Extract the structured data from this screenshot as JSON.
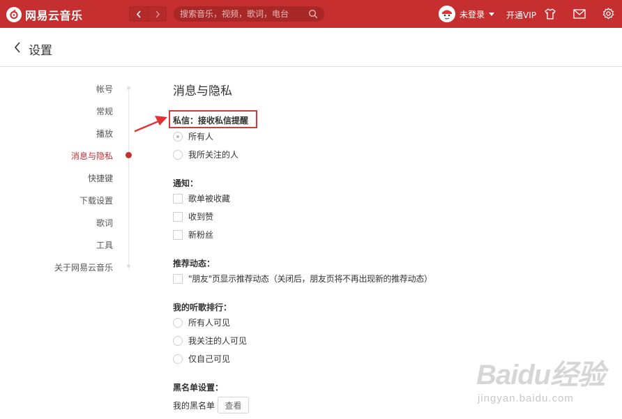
{
  "app": {
    "name": "网易云音乐",
    "search_placeholder": "搜索音乐，视频，歌词，电台",
    "user_name": "未登录",
    "vip_label": "开通VIP",
    "brand_color": "#c62f2f"
  },
  "header": {
    "title": "设置"
  },
  "sidebar": {
    "items": [
      {
        "label": "帐号",
        "active": false
      },
      {
        "label": "常规",
        "active": false
      },
      {
        "label": "播放",
        "active": false
      },
      {
        "label": "消息与隐私",
        "active": true
      },
      {
        "label": "快捷键",
        "active": false
      },
      {
        "label": "下载设置",
        "active": false
      },
      {
        "label": "歌词",
        "active": false
      },
      {
        "label": "工具",
        "active": false
      },
      {
        "label": "关于网易云音乐",
        "active": false
      }
    ]
  },
  "content": {
    "section_title": "消息与隐私",
    "private_message": {
      "label": "私信：接收私信提醒",
      "options": [
        {
          "label": "所有人",
          "checked": true
        },
        {
          "label": "我所关注的人",
          "checked": false
        }
      ]
    },
    "notifications": {
      "label": "通知：",
      "options": [
        {
          "label": "歌单被收藏",
          "checked": false
        },
        {
          "label": "收到赞",
          "checked": false
        },
        {
          "label": "新粉丝",
          "checked": false
        }
      ]
    },
    "recommend": {
      "label": "推荐动态：",
      "options": [
        {
          "label": "\"朋友\"页显示推荐动态（关闭后，朋友页将不再出现新的推荐动态）",
          "checked": false
        }
      ]
    },
    "ranking": {
      "label": "我的听歌排行：",
      "options": [
        {
          "label": "所有人可见",
          "checked": false
        },
        {
          "label": "我关注的人可见",
          "checked": false
        },
        {
          "label": "仅自己可见",
          "checked": false
        }
      ]
    },
    "blacklist": {
      "label": "黑名单设置：",
      "row_label": "我的黑名单",
      "button_label": "查看"
    }
  },
  "watermark": {
    "main": "Baidu经验",
    "sub": "jingyan.baidu.com"
  }
}
